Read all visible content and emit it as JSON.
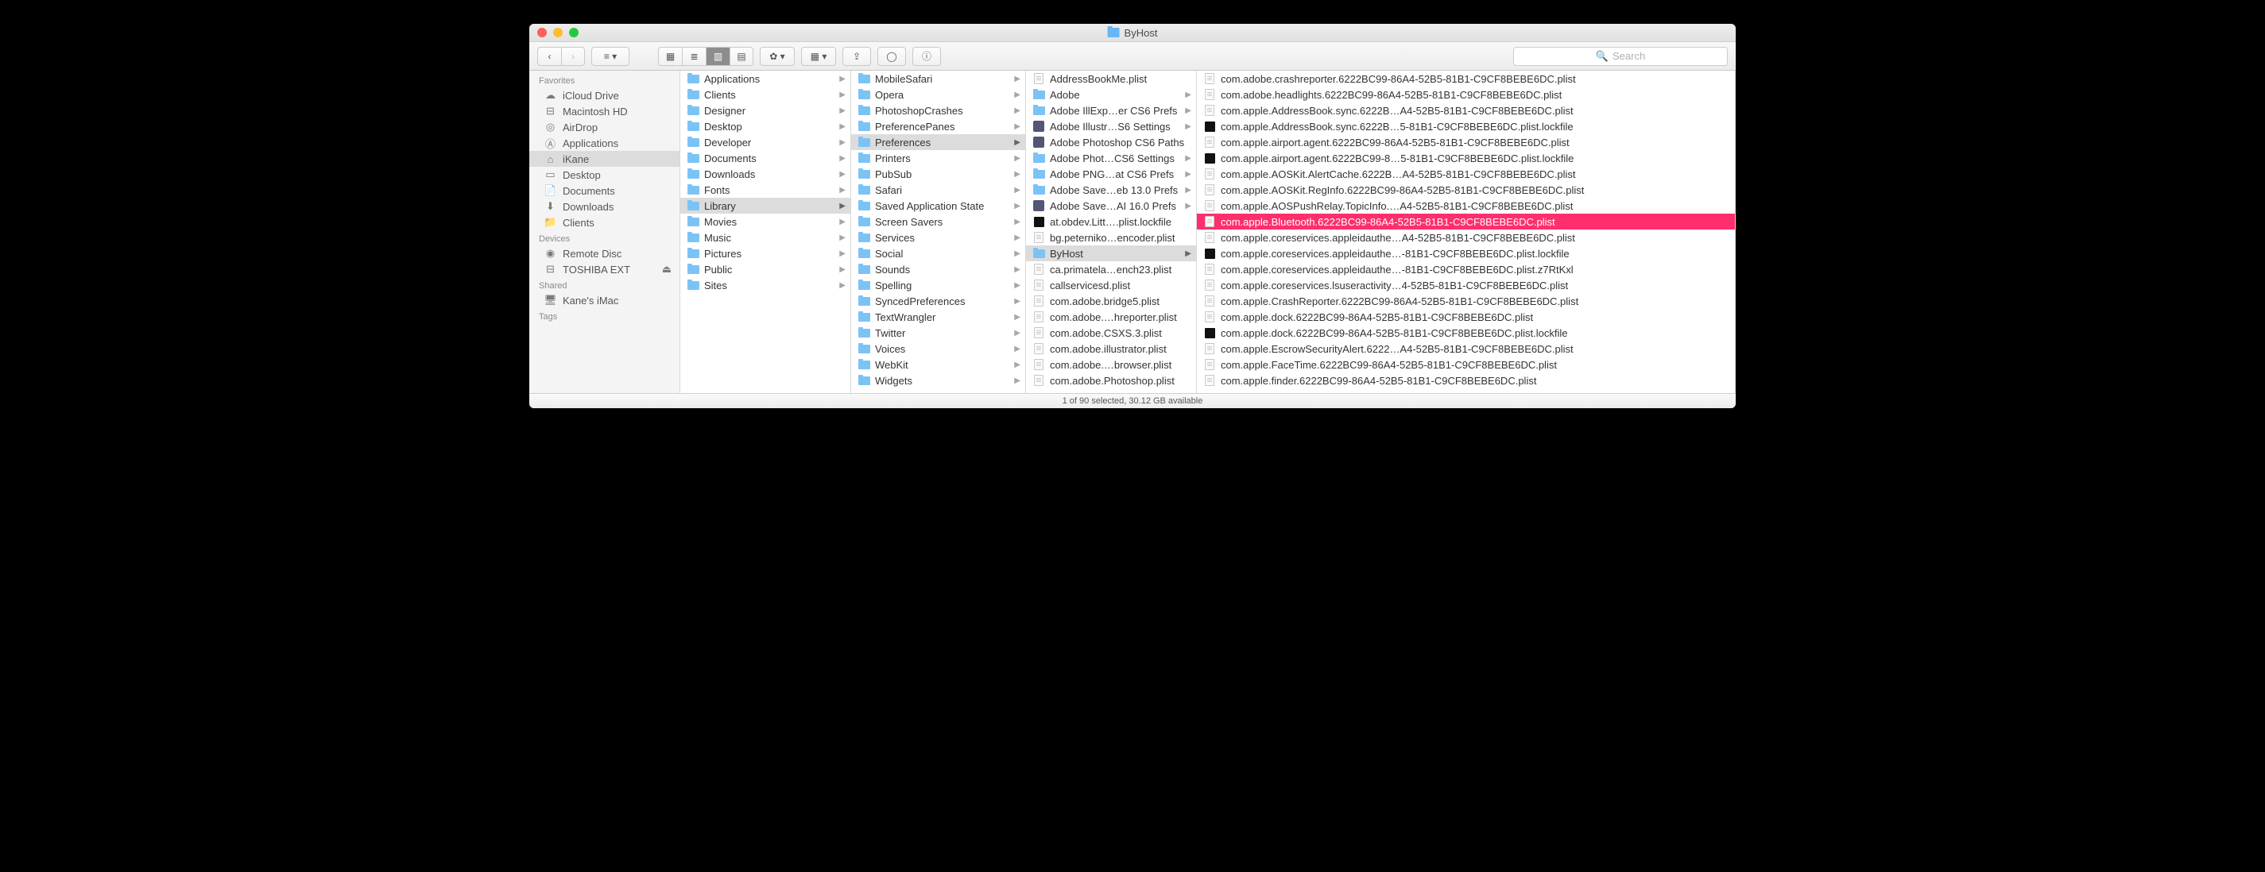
{
  "window": {
    "title": "ByHost"
  },
  "search": {
    "placeholder": "Search"
  },
  "status": "1 of 90 selected, 30.12 GB available",
  "sidebar": {
    "sections": [
      {
        "title": "Favorites",
        "items": [
          {
            "icon": "cloud",
            "label": "iCloud Drive"
          },
          {
            "icon": "disk",
            "label": "Macintosh HD"
          },
          {
            "icon": "airdrop",
            "label": "AirDrop"
          },
          {
            "icon": "apps",
            "label": "Applications"
          },
          {
            "icon": "home",
            "label": "iKane",
            "selected": true
          },
          {
            "icon": "desktop",
            "label": "Desktop"
          },
          {
            "icon": "docs",
            "label": "Documents"
          },
          {
            "icon": "down",
            "label": "Downloads"
          },
          {
            "icon": "folder",
            "label": "Clients"
          }
        ]
      },
      {
        "title": "Devices",
        "items": [
          {
            "icon": "disc",
            "label": "Remote Disc"
          },
          {
            "icon": "ext",
            "label": "TOSHIBA EXT",
            "eject": true
          }
        ]
      },
      {
        "title": "Shared",
        "items": [
          {
            "icon": "monitor",
            "label": "Kane's iMac"
          }
        ]
      },
      {
        "title": "Tags",
        "items": []
      }
    ]
  },
  "columns": [
    {
      "items": [
        {
          "t": "folder",
          "n": "Applications",
          "a": true
        },
        {
          "t": "folder",
          "n": "Clients",
          "a": true
        },
        {
          "t": "folder",
          "n": "Designer",
          "a": true
        },
        {
          "t": "folder",
          "n": "Desktop",
          "a": true
        },
        {
          "t": "folder",
          "n": "Developer",
          "a": true
        },
        {
          "t": "folder",
          "n": "Documents",
          "a": true
        },
        {
          "t": "folder",
          "n": "Downloads",
          "a": true
        },
        {
          "t": "folder",
          "n": "Fonts",
          "a": true
        },
        {
          "t": "folder",
          "n": "Library",
          "a": true,
          "sel": true
        },
        {
          "t": "folder",
          "n": "Movies",
          "a": true
        },
        {
          "t": "folder",
          "n": "Music",
          "a": true
        },
        {
          "t": "folder",
          "n": "Pictures",
          "a": true
        },
        {
          "t": "folder",
          "n": "Public",
          "a": true
        },
        {
          "t": "folder",
          "n": "Sites",
          "a": true
        }
      ]
    },
    {
      "items": [
        {
          "t": "folder",
          "n": "MobileSafari",
          "a": true
        },
        {
          "t": "folder",
          "n": "Opera",
          "a": true
        },
        {
          "t": "folder",
          "n": "PhotoshopCrashes",
          "a": true
        },
        {
          "t": "folder",
          "n": "PreferencePanes",
          "a": true
        },
        {
          "t": "folder",
          "n": "Preferences",
          "a": true,
          "sel": true
        },
        {
          "t": "folder",
          "n": "Printers",
          "a": true
        },
        {
          "t": "folder",
          "n": "PubSub",
          "a": true
        },
        {
          "t": "folder",
          "n": "Safari",
          "a": true
        },
        {
          "t": "folder",
          "n": "Saved Application State",
          "a": true
        },
        {
          "t": "folder",
          "n": "Screen Savers",
          "a": true
        },
        {
          "t": "folder",
          "n": "Services",
          "a": true
        },
        {
          "t": "folder",
          "n": "Social",
          "a": true
        },
        {
          "t": "folder",
          "n": "Sounds",
          "a": true
        },
        {
          "t": "folder",
          "n": "Spelling",
          "a": true
        },
        {
          "t": "folder",
          "n": "SyncedPreferences",
          "a": true
        },
        {
          "t": "folder",
          "n": "TextWrangler",
          "a": true
        },
        {
          "t": "folder",
          "n": "Twitter",
          "a": true
        },
        {
          "t": "folder",
          "n": "Voices",
          "a": true
        },
        {
          "t": "folder",
          "n": "WebKit",
          "a": true
        },
        {
          "t": "folder",
          "n": "Widgets",
          "a": true
        }
      ]
    },
    {
      "items": [
        {
          "t": "file",
          "n": "AddressBookMe.plist"
        },
        {
          "t": "folder",
          "n": "Adobe",
          "a": true
        },
        {
          "t": "folder",
          "n": "Adobe IllExp…er CS6 Prefs",
          "a": true
        },
        {
          "t": "app",
          "n": "Adobe Illustr…S6 Settings",
          "a": true
        },
        {
          "t": "app",
          "n": "Adobe Photoshop CS6 Paths"
        },
        {
          "t": "folder",
          "n": "Adobe Phot…CS6 Settings",
          "a": true
        },
        {
          "t": "folder",
          "n": "Adobe PNG…at CS6 Prefs",
          "a": true
        },
        {
          "t": "folder",
          "n": "Adobe Save…eb 13.0 Prefs",
          "a": true
        },
        {
          "t": "app",
          "n": "Adobe Save…AI 16.0 Prefs",
          "a": true
        },
        {
          "t": "lock",
          "n": "at.obdev.Litt….plist.lockfile"
        },
        {
          "t": "file",
          "n": "bg.peterniko…encoder.plist"
        },
        {
          "t": "folder",
          "n": "ByHost",
          "a": true,
          "sel": true
        },
        {
          "t": "file",
          "n": "ca.primatela…ench23.plist"
        },
        {
          "t": "file",
          "n": "callservicesd.plist"
        },
        {
          "t": "file",
          "n": "com.adobe.bridge5.plist"
        },
        {
          "t": "file",
          "n": "com.adobe.…hreporter.plist"
        },
        {
          "t": "file",
          "n": "com.adobe.CSXS.3.plist"
        },
        {
          "t": "file",
          "n": "com.adobe.illustrator.plist"
        },
        {
          "t": "file",
          "n": "com.adobe.…browser.plist"
        },
        {
          "t": "file",
          "n": "com.adobe.Photoshop.plist"
        }
      ]
    },
    {
      "items": [
        {
          "t": "file",
          "n": "com.adobe.crashreporter.6222BC99-86A4-52B5-81B1-C9CF8BEBE6DC.plist"
        },
        {
          "t": "file",
          "n": "com.adobe.headlights.6222BC99-86A4-52B5-81B1-C9CF8BEBE6DC.plist"
        },
        {
          "t": "file",
          "n": "com.apple.AddressBook.sync.6222B…A4-52B5-81B1-C9CF8BEBE6DC.plist"
        },
        {
          "t": "lock",
          "n": "com.apple.AddressBook.sync.6222B…5-81B1-C9CF8BEBE6DC.plist.lockfile"
        },
        {
          "t": "file",
          "n": "com.apple.airport.agent.6222BC99-86A4-52B5-81B1-C9CF8BEBE6DC.plist"
        },
        {
          "t": "lock",
          "n": "com.apple.airport.agent.6222BC99-8…5-81B1-C9CF8BEBE6DC.plist.lockfile"
        },
        {
          "t": "file",
          "n": "com.apple.AOSKit.AlertCache.6222B…A4-52B5-81B1-C9CF8BEBE6DC.plist"
        },
        {
          "t": "file",
          "n": "com.apple.AOSKit.RegInfo.6222BC99-86A4-52B5-81B1-C9CF8BEBE6DC.plist"
        },
        {
          "t": "file",
          "n": "com.apple.AOSPushRelay.TopicInfo.…A4-52B5-81B1-C9CF8BEBE6DC.plist"
        },
        {
          "t": "file",
          "n": "com.apple.Bluetooth.6222BC99-86A4-52B5-81B1-C9CF8BEBE6DC.plist",
          "hl": true
        },
        {
          "t": "file",
          "n": "com.apple.coreservices.appleidauthe…A4-52B5-81B1-C9CF8BEBE6DC.plist"
        },
        {
          "t": "lock",
          "n": "com.apple.coreservices.appleidauthe…-81B1-C9CF8BEBE6DC.plist.lockfile"
        },
        {
          "t": "file",
          "n": "com.apple.coreservices.appleidauthe…-81B1-C9CF8BEBE6DC.plist.z7RtKxl"
        },
        {
          "t": "file",
          "n": "com.apple.coreservices.lsuseractivity…4-52B5-81B1-C9CF8BEBE6DC.plist"
        },
        {
          "t": "file",
          "n": "com.apple.CrashReporter.6222BC99-86A4-52B5-81B1-C9CF8BEBE6DC.plist"
        },
        {
          "t": "file",
          "n": "com.apple.dock.6222BC99-86A4-52B5-81B1-C9CF8BEBE6DC.plist"
        },
        {
          "t": "lock",
          "n": "com.apple.dock.6222BC99-86A4-52B5-81B1-C9CF8BEBE6DC.plist.lockfile"
        },
        {
          "t": "file",
          "n": "com.apple.EscrowSecurityAlert.6222…A4-52B5-81B1-C9CF8BEBE6DC.plist"
        },
        {
          "t": "file",
          "n": "com.apple.FaceTime.6222BC99-86A4-52B5-81B1-C9CF8BEBE6DC.plist"
        },
        {
          "t": "file",
          "n": "com.apple.finder.6222BC99-86A4-52B5-81B1-C9CF8BEBE6DC.plist"
        }
      ]
    }
  ]
}
